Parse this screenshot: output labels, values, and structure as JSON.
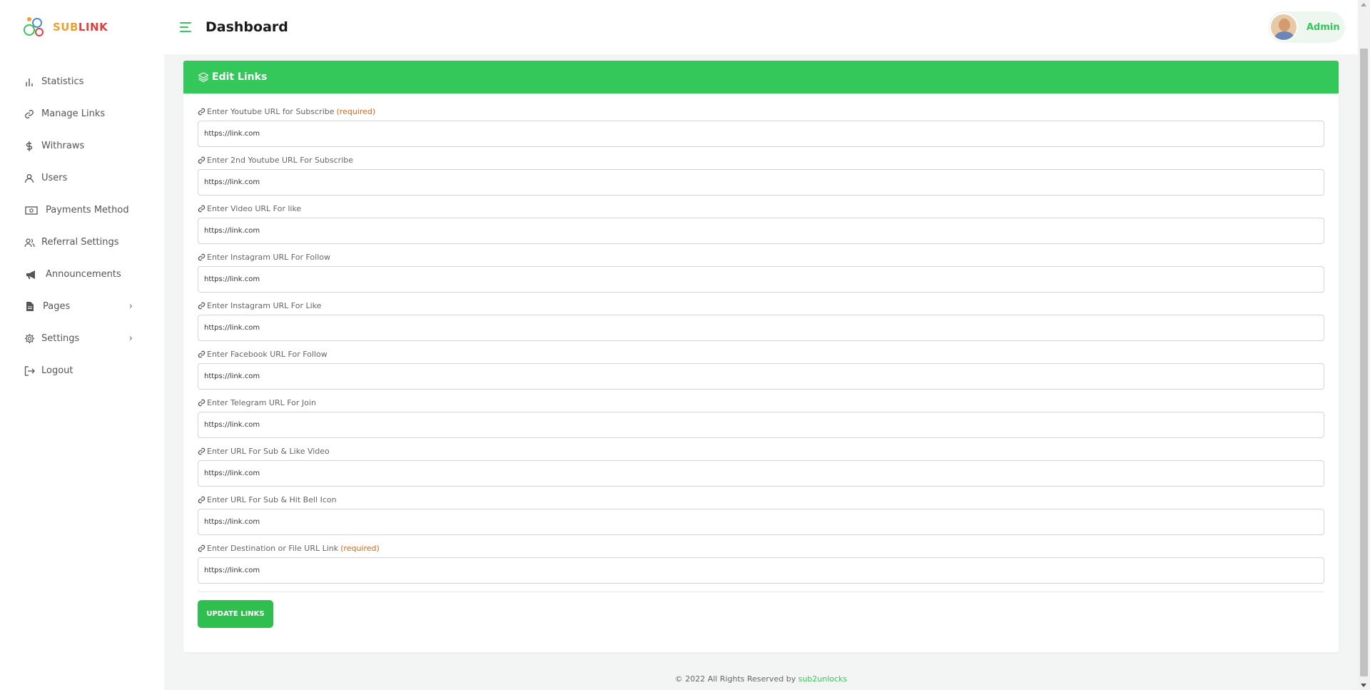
{
  "brand": {
    "name_part1": "SUB",
    "name_part2": "LINK",
    "color_primary": "#34c759"
  },
  "sidebar": {
    "items": [
      {
        "label": "Statistics",
        "icon": "bar-chart-icon"
      },
      {
        "label": "Manage Links",
        "icon": "link-icon"
      },
      {
        "label": "Withraws",
        "icon": "dollar-icon"
      },
      {
        "label": "Users",
        "icon": "user-icon"
      },
      {
        "label": "Payments Method",
        "icon": "money-icon"
      },
      {
        "label": "Referral Settings",
        "icon": "users-icon"
      },
      {
        "label": "Announcements",
        "icon": "megaphone-icon"
      },
      {
        "label": "Pages",
        "icon": "file-icon",
        "has_submenu": true
      },
      {
        "label": "Settings",
        "icon": "gear-icon",
        "has_submenu": true
      },
      {
        "label": "Logout",
        "icon": "logout-icon"
      }
    ]
  },
  "header": {
    "title": "Dashboard",
    "user_name": "Admin"
  },
  "card": {
    "title": "Edit Links",
    "fields": [
      {
        "label": "Enter Youtube URL for Subscribe",
        "required_text": "(required)",
        "value": "https://link.com"
      },
      {
        "label": "Enter 2nd Youtube URL For Subscribe",
        "required_text": "",
        "value": "https://link.com"
      },
      {
        "label": "Enter Video URL For like",
        "required_text": "",
        "value": "https://link.com"
      },
      {
        "label": "Enter Instagram URL For Follow",
        "required_text": "",
        "value": "https://link.com"
      },
      {
        "label": "Enter Instagram URL For Like",
        "required_text": "",
        "value": "https://link.com"
      },
      {
        "label": "Enter Facebook URL For Follow",
        "required_text": "",
        "value": "https://link.com"
      },
      {
        "label": "Enter Telegram URL For Join",
        "required_text": "",
        "value": "https://link.com"
      },
      {
        "label": "Enter URL For Sub & Like Video",
        "required_text": "",
        "value": "https://link.com"
      },
      {
        "label": "Enter URL For Sub & Hit Bell Icon",
        "required_text": "",
        "value": "https://link.com"
      },
      {
        "label": "Enter Destination or File URL Link",
        "required_text": "(required)",
        "value": "https://link.com"
      }
    ],
    "submit_label": "UPDATE LINKS"
  },
  "footer": {
    "text": "© 2022 All Rights Reserved by",
    "link_text": "sub2unlocks"
  }
}
